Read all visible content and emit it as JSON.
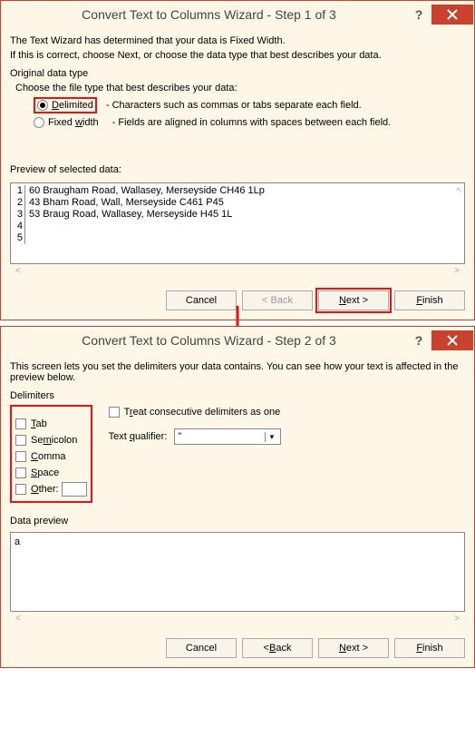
{
  "dlg1": {
    "title": "Convert Text to Columns Wizard - Step 1 of 3",
    "intro1": "The Text Wizard has determined that your data is Fixed Width.",
    "intro2": "If this is correct, choose Next, or choose the data type that best describes your data.",
    "group": "Original data type",
    "choose": "Choose the file type that best describes your data:",
    "r1": "Delimited",
    "r1desc": "- Characters such as commas or tabs separate each field.",
    "r2": "Fixed width",
    "r2desc": "- Fields are aligned in columns with spaces between each field.",
    "previewLabel": "Preview of selected data:",
    "rows": [
      {
        "n": "1",
        "t": "60 Braugham Road, Wallasey, Merseyside CH46 1Lp"
      },
      {
        "n": "2",
        "t": "43 Bham Road, Wall, Merseyside C461 P45"
      },
      {
        "n": "3",
        "t": "53 Braug Road, Wallasey, Merseyside H45 1L"
      },
      {
        "n": "4",
        "t": ""
      },
      {
        "n": "5",
        "t": ""
      }
    ],
    "btnCancel": "Cancel",
    "btnBack": "< Back",
    "btnNext": "Next >",
    "btnFinish": "Finish"
  },
  "dlg2": {
    "title": "Convert Text to Columns Wizard - Step 2 of 3",
    "intro": "This screen lets you set the delimiters your data contains.  You can see how your text is affected in the preview below.",
    "group": "Delimiters",
    "items": [
      "Tab",
      "Semicolon",
      "Comma",
      "Space",
      "Other:"
    ],
    "consec": "Treat consecutive delimiters as one",
    "qualLabel": "Text qualifier:",
    "qualValue": "\"",
    "dpLabel": "Data preview",
    "dpContent": "a",
    "btnCancel": "Cancel",
    "btnBack": "< Back",
    "btnNext": "Next >",
    "btnFinish": "Finish"
  }
}
